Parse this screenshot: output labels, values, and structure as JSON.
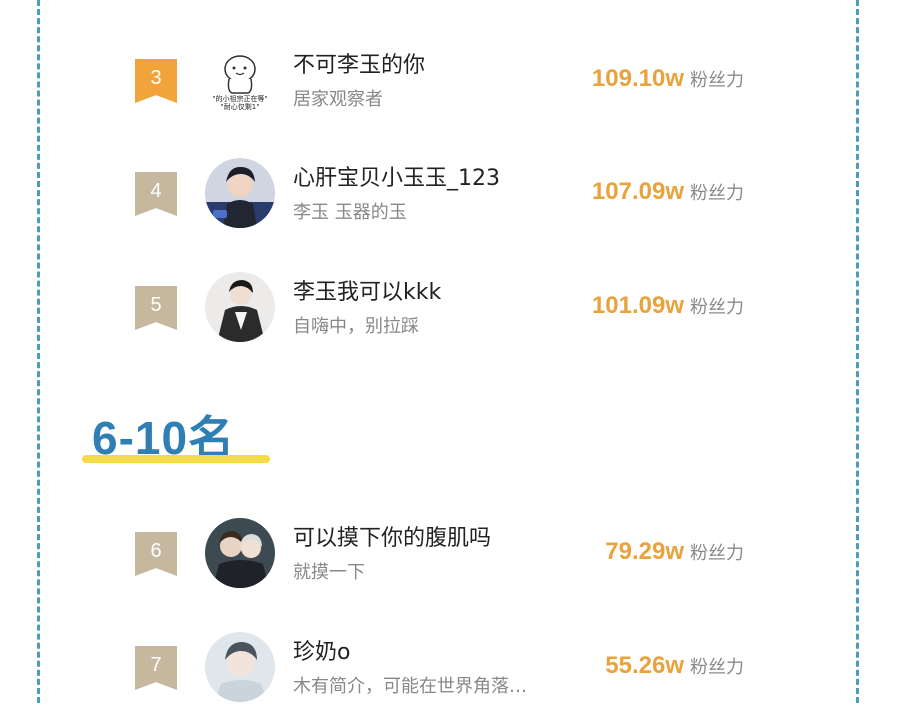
{
  "section_heading": "6-10名",
  "fans_unit": "粉丝力",
  "rows": [
    {
      "rank": "3",
      "name": "不可李玉的你",
      "bio": "居家观察者",
      "fans": "109.10w",
      "avatar_caption": "\"的小祖宗正在等\"\n\"耐心仅剩1\"",
      "badge": "gold"
    },
    {
      "rank": "4",
      "name": "心肝宝贝小玉玉_123",
      "bio": "李玉 玉器的玉",
      "fans": "107.09w",
      "badge": "plain"
    },
    {
      "rank": "5",
      "name": "李玉我可以kkk",
      "bio": "自嗨中，别拉踩",
      "fans": "101.09w",
      "badge": "plain"
    },
    {
      "rank": "6",
      "name": "可以摸下你的腹肌吗",
      "bio": "就摸一下",
      "fans": "79.29w",
      "badge": "plain"
    },
    {
      "rank": "7",
      "name": "珍奶o",
      "bio": "木有简介，可能在世界角落…",
      "fans": "55.26w",
      "badge": "plain"
    }
  ],
  "colors": {
    "frame": "#4a9fb8",
    "badge_gold": "#f2a33a",
    "badge_plain": "#c6b79f",
    "fans_count": "#e8a33d",
    "heading": "#2f7fb5",
    "heading_underline": "#f3dc47"
  }
}
